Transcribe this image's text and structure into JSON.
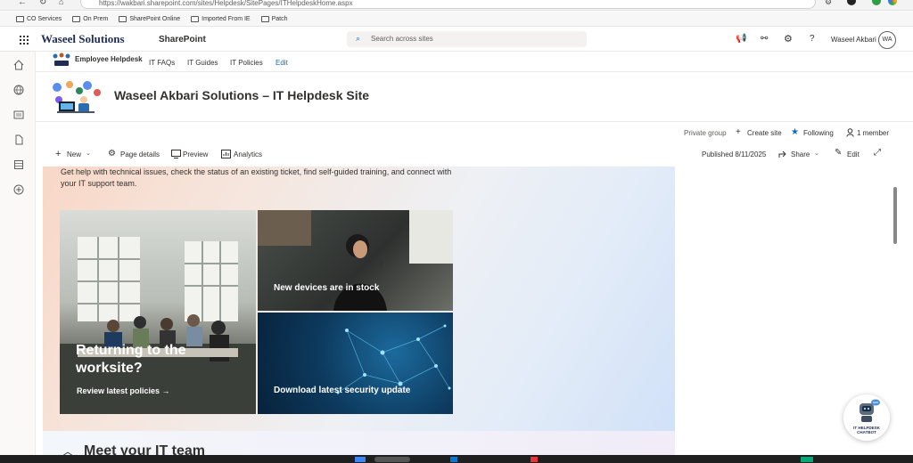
{
  "browser": {
    "url": "https://wakbari.sharepoint.com/sites/Helpdesk/SitePages/ITHelpdeskHome.aspx",
    "bookmarks": [
      "CO Services",
      "On Prem",
      "SharePoint Online",
      "Imported From IE",
      "Patch"
    ]
  },
  "suite": {
    "logo_text": "Waseel Solutions",
    "app_name": "SharePoint",
    "search_placeholder": "Search across sites",
    "user_name": "Waseel Akbari",
    "user_initials": "WA"
  },
  "hub": {
    "site_name": "Employee Helpdesk",
    "links": [
      "IT FAQs",
      "IT Guides",
      "IT Policies"
    ],
    "edit_label": "Edit"
  },
  "site": {
    "title": "Waseel Akbari Solutions – IT Helpdesk Site",
    "group_type": "Private group",
    "create_site": "Create site",
    "following": "Following",
    "members": "1 member"
  },
  "commands": {
    "new": "New",
    "page_details": "Page details",
    "preview": "Preview",
    "analytics": "Analytics",
    "published": "Published 8/11/2025",
    "share": "Share",
    "edit": "Edit"
  },
  "page": {
    "intro": "Get help with technical issues, check the status of an existing ticket, find self-guided training, and connect with your IT support team.",
    "tiles": {
      "main_title": "Returning to the worksite?",
      "main_link": "Review latest policies →",
      "devices": "New devices are in stock",
      "security": "Download latest security update"
    },
    "section_title": "Meet your IT team"
  },
  "chatbot": {
    "label": "IT HELPDESK CHATBOT"
  },
  "colors": {
    "accent": "#0078d4",
    "following_star": "#0f6cbd",
    "edit_link": "#0f6cbd"
  }
}
